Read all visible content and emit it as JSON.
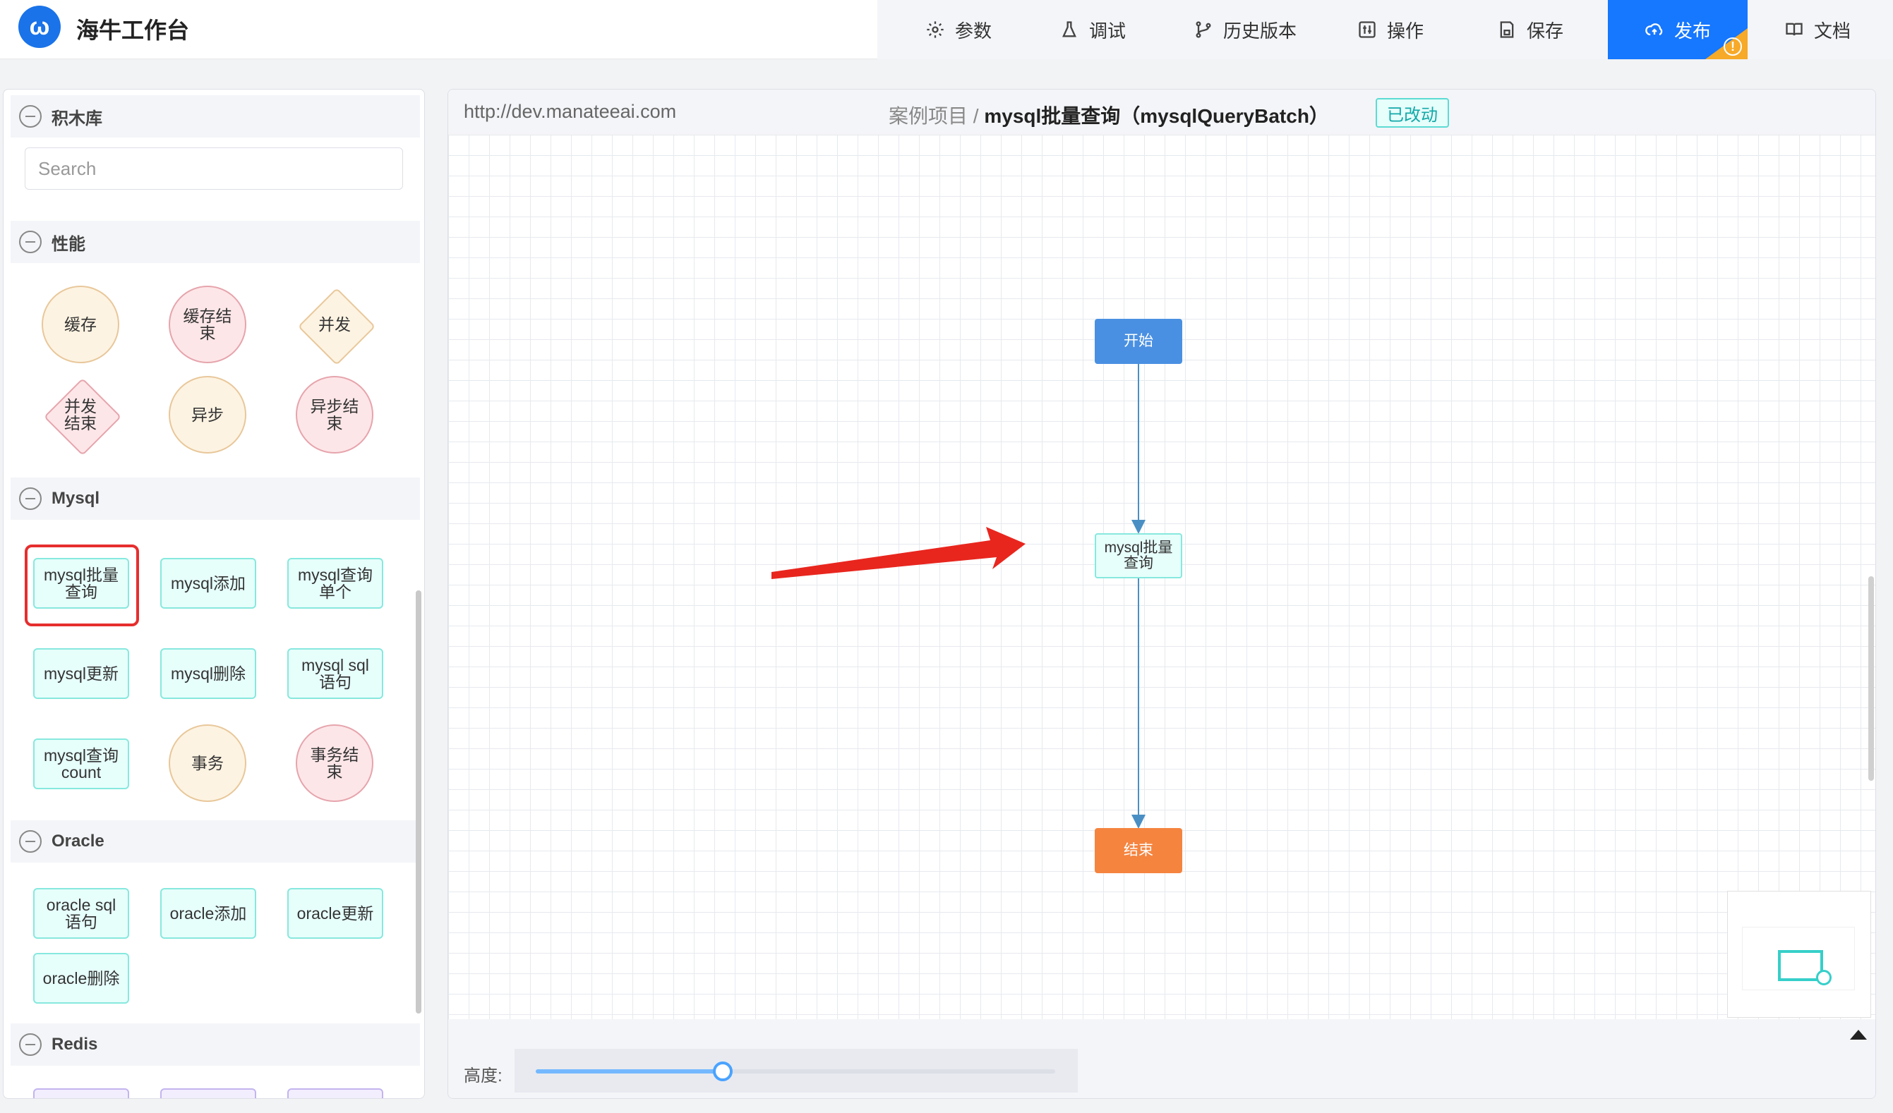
{
  "app": {
    "brand": "海牛工作台",
    "logo": "ω"
  },
  "menu": [
    {
      "label": "参数",
      "icon": "gear-icon"
    },
    {
      "label": "调试",
      "icon": "flask-icon"
    },
    {
      "label": "历史版本",
      "icon": "branch-icon"
    },
    {
      "label": "操作",
      "icon": "sliders-icon"
    },
    {
      "label": "保存",
      "icon": "save-icon"
    },
    {
      "label": "发布",
      "icon": "cloud-upload-icon",
      "active": true,
      "badge": "!"
    },
    {
      "label": "文档",
      "icon": "book-icon"
    }
  ],
  "library": {
    "title": "积木库",
    "search_placeholder": "Search",
    "sections": {
      "perf": "性能",
      "mysql": "Mysql",
      "oracle": "Oracle",
      "redis": "Redis"
    },
    "perf_blocks": [
      "缓存",
      "缓存结束",
      "并发",
      "并发结束",
      "异步",
      "异步结束"
    ],
    "mysql_blocks": [
      "mysql批量查询",
      "mysql添加",
      "mysql查询单个",
      "mysql更新",
      "mysql删除",
      "mysql sql语句",
      "mysql查询count",
      "事务",
      "事务结束"
    ],
    "oracle_blocks": [
      "oracle sql语句",
      "oracle添加",
      "oracle更新",
      "oracle删除"
    ]
  },
  "canvas": {
    "url": "http://dev.manateeai.com",
    "project": "案例项目",
    "separator": "/",
    "flow_name": "mysql批量查询（mysqlQueryBatch）",
    "status": "已改动",
    "nodes": {
      "start": "开始",
      "mid": "mysql批量查询",
      "end": "结束"
    },
    "height_label": "高度:",
    "height_value": 0.36
  },
  "colors": {
    "accent": "#1677ff",
    "warn": "#f7a928",
    "arrow": "#e8261e",
    "edge": "#4a8fc4"
  }
}
